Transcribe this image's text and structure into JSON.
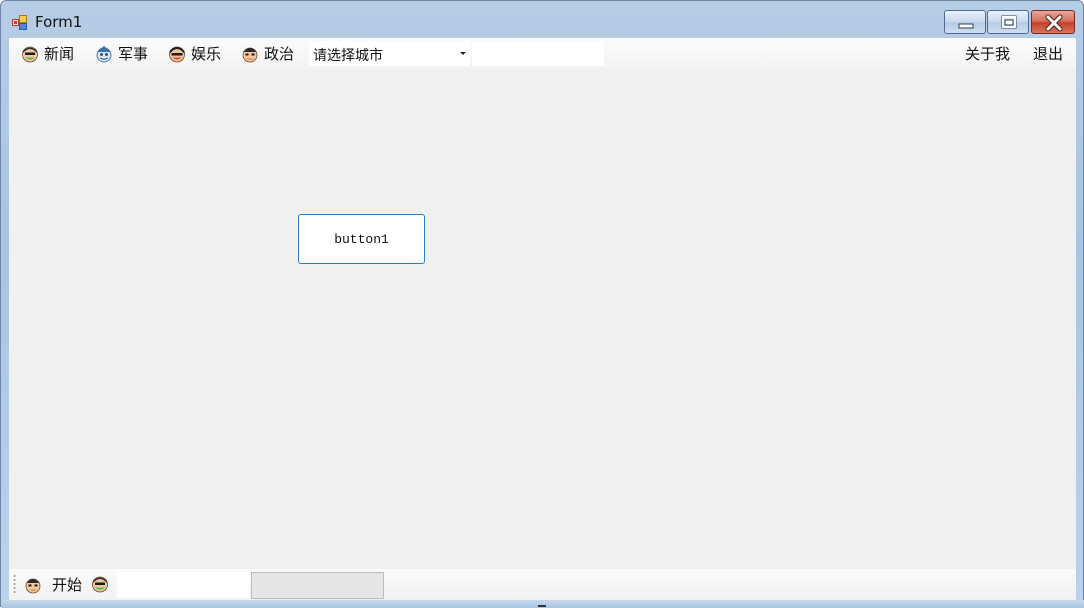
{
  "window": {
    "title": "Form1",
    "icon": "winforms-app-icon",
    "controls": {
      "minimize": "minimize-icon",
      "maximize": "maximize-icon",
      "close": "close-icon"
    }
  },
  "menu": {
    "items": [
      {
        "label": "新闻",
        "icon": "face-icon"
      },
      {
        "label": "军事",
        "icon": "face-icon"
      },
      {
        "label": "娱乐",
        "icon": "face-icon"
      },
      {
        "label": "政治",
        "icon": "face-icon"
      }
    ],
    "combo": {
      "selected": "请选择城市"
    },
    "textbox": {
      "value": ""
    },
    "right_items": [
      {
        "label": "关于我"
      },
      {
        "label": "退出"
      }
    ]
  },
  "main": {
    "button1_label": "button1"
  },
  "status": {
    "start_label": "开始",
    "textbox_value": "",
    "progress": 0
  },
  "colors": {
    "accent_border": "#2b7bc4",
    "close_button": "#c2412a",
    "client_bg": "#f0f0f0"
  }
}
